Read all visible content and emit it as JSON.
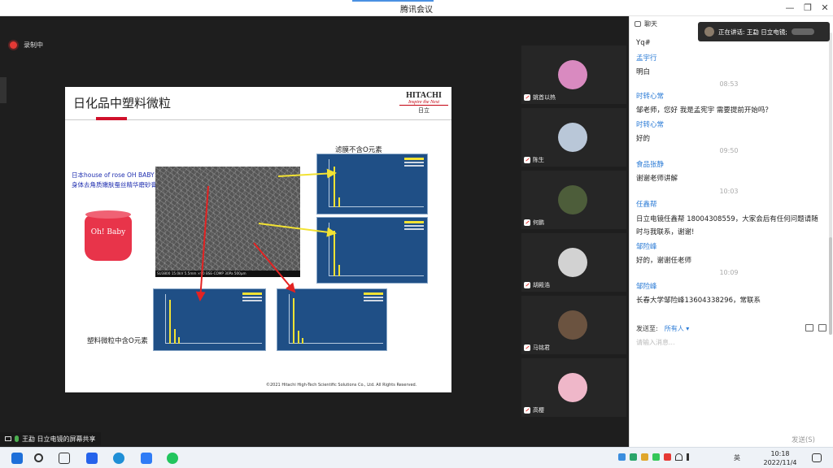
{
  "window": {
    "title": "腾讯会议"
  },
  "recording": {
    "label": "录制中"
  },
  "slide": {
    "title": "日化品中塑料微粒",
    "logo": {
      "brand": "HITACHI",
      "tagline": "Inspire the Next",
      "jp": "日立"
    },
    "product_label": "日本house of rose OH BABY身体去角质嫩肤蚕丝精华磨砂膏",
    "jar_brand": "Oh! Baby",
    "label_top": "滤膜不含O元素",
    "label_bottom": "塑料微粒中含O元素",
    "sem_caption": "SU3800 15.0kV 5.5mm ×90 BSE-COMP 30Pa        500μm",
    "copyright": "©2021 Hitachi High-Tech Scientific Solutions Co., Ltd. All Rights Reserved."
  },
  "participants": [
    {
      "name": "姚首以热",
      "avatar_color": "#d98ac0"
    },
    {
      "name": "陈生",
      "avatar_color": "#b9c7d8"
    },
    {
      "name": "何鹏",
      "avatar_color": "#4d5d3a"
    },
    {
      "name": "胡殿浩",
      "avatar_color": "#d2d2d2"
    },
    {
      "name": "马铭君",
      "avatar_color": "#6b5340"
    },
    {
      "name": "高樱",
      "avatar_color": "#efb7c9"
    }
  ],
  "chat": {
    "header": "聊天",
    "speaking": "正在讲话: 王勐 日立电镜;",
    "messages": [
      {
        "sender": "",
        "text": "Yq#"
      },
      {
        "sender": "孟宇行",
        "text": "明白"
      },
      {
        "time": "08:53"
      },
      {
        "sender": "时转心常",
        "text": "邹老师，您好 我是孟宪宇 需要提前开始吗？"
      },
      {
        "sender": "时转心常",
        "text": "好的"
      },
      {
        "time": "09:50"
      },
      {
        "sender": "食品张静",
        "text": "谢谢老师讲解"
      },
      {
        "time": "10:03"
      },
      {
        "sender": "任鑫帮",
        "text": "日立电镜任鑫帮 18004308559，大家会后有任何问题请随时与我联系，谢谢!"
      },
      {
        "sender": "邹险峰",
        "text": "好的，谢谢任老师"
      },
      {
        "time": "10:09"
      },
      {
        "sender": "邹险峰",
        "text": "长春大学邹险峰13604338296，常联系"
      }
    ],
    "send_to_label": "发送至:",
    "send_to_target": "所有人 ▾",
    "input_placeholder": "请输入消息...",
    "send_button": "发送(S)"
  },
  "sharebar": {
    "text": "王勐 日立电镜的屏幕共享"
  },
  "taskbar": {
    "ime": "英",
    "time": "10:18",
    "date": "2022/11/4"
  }
}
